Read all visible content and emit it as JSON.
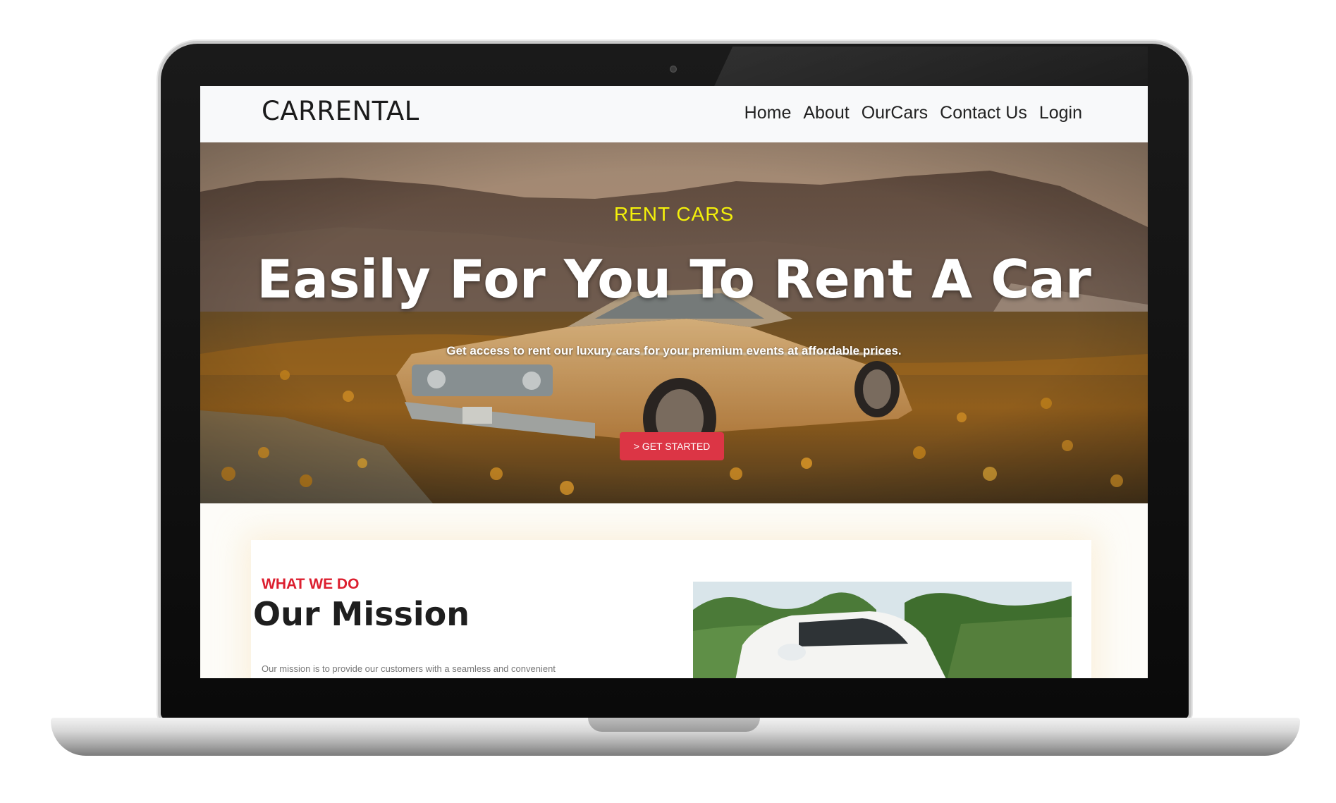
{
  "site": {
    "brand": "CARRENTAL",
    "nav": [
      {
        "label": "Home"
      },
      {
        "label": "About"
      },
      {
        "label": "OurCars"
      },
      {
        "label": "Contact Us"
      },
      {
        "label": "Login"
      }
    ]
  },
  "hero": {
    "eyebrow": "RENT CARS",
    "title": "Easily For You To Rent A Car",
    "subtitle": "Get access to rent our luxury cars for your premium events at affordable prices.",
    "cta_label": "> GET STARTED",
    "cta_color": "#dc3545",
    "eyebrow_color": "#f4f10a"
  },
  "mission": {
    "eyebrow": "WHAT WE DO",
    "title": "Our Mission",
    "text": "Our mission is to provide our customers with a seamless and convenient"
  },
  "colors": {
    "accent_red": "#dc1f2f",
    "navbar_bg": "#f8f9fa"
  }
}
